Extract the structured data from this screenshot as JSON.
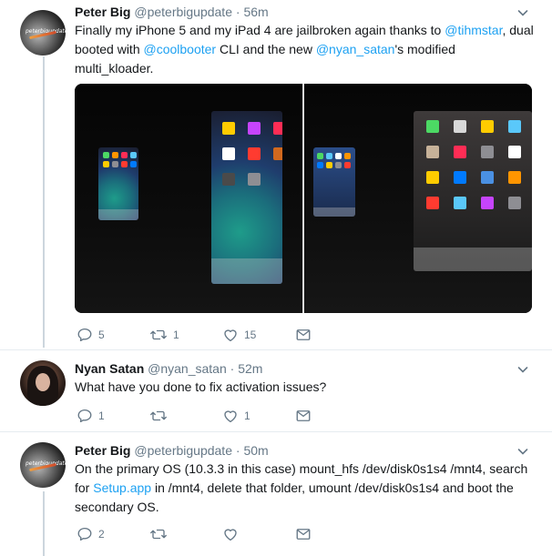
{
  "tweets": [
    {
      "name": "Peter Big",
      "handle": "@peterbigupdate",
      "dot": "·",
      "time": "56m",
      "body": {
        "t1": "Finally my iPhone 5 and my iPad 4 are jailbroken again thanks to ",
        "m1": "@tihmstar",
        "t2": ", dual booted with ",
        "m2": "@coolbooter",
        "t3": " CLI and the new ",
        "m3": "@nyan_satan",
        "t4": "'s modified multi_kloader."
      },
      "avatar_text": "peterbigupdate",
      "counts": {
        "reply": "5",
        "retweet": "1",
        "like": "15"
      }
    },
    {
      "name": "Nyan Satan",
      "handle": "@nyan_satan",
      "dot": "·",
      "time": "52m",
      "body": {
        "t1": "What have you done to fix activation issues?"
      },
      "counts": {
        "reply": "1",
        "retweet": "",
        "like": "1"
      }
    },
    {
      "name": "Peter Big",
      "handle": "@peterbigupdate",
      "dot": "·",
      "time": "50m",
      "body": {
        "t1": "On the primary OS (10.3.3 in this case) mount_hfs /dev/disk0s1s4 /mnt4, search for ",
        "l1": "Setup.app",
        "t2": " in /mnt4, delete that folder, umount /dev/disk0s1s4 and boot the secondary OS."
      },
      "avatar_text": "peterbigupdate",
      "counts": {
        "reply": "2",
        "retweet": "",
        "like": ""
      }
    }
  ],
  "colors": {
    "text": "#14171a",
    "secondary": "#657786",
    "link": "#1da1f2",
    "separator": "#e6ecf0",
    "thread_line": "#ccd6dd"
  },
  "icons": [
    "chevron-down-icon",
    "reply-icon",
    "retweet-icon",
    "like-icon",
    "message-icon"
  ]
}
